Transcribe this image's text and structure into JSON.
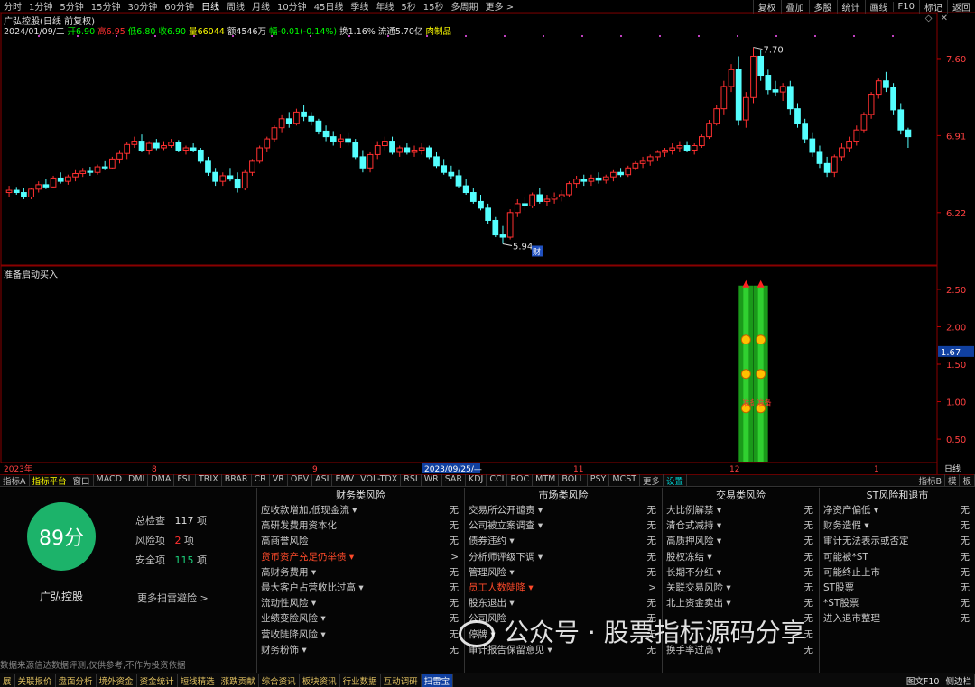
{
  "timeframes": [
    "分时",
    "1分钟",
    "5分钟",
    "15分钟",
    "30分钟",
    "60分钟",
    "日线",
    "周线",
    "月线",
    "10分钟",
    "45日线",
    "季线",
    "年线",
    "5秒",
    "15秒",
    "多周期",
    "更多 >"
  ],
  "active_timeframe_index": 6,
  "right_buttons": [
    "复权",
    "叠加",
    "多股",
    "统计",
    "画线",
    "F10",
    "标记",
    "返回"
  ],
  "chart_title": "广弘控股(日线 前复权)",
  "quote": [
    {
      "text": "2024/01/09/二",
      "color": "#e0e0e0"
    },
    {
      "text": "开6.90",
      "color": "#00ff00"
    },
    {
      "text": "高6.95",
      "color": "#ff3030"
    },
    {
      "text": "低6.80",
      "color": "#00ff00"
    },
    {
      "text": "收6.90",
      "color": "#00ff00"
    },
    {
      "text": "量66044",
      "color": "#ffff00"
    },
    {
      "text": "额4546万",
      "color": "#e0e0e0"
    },
    {
      "text": "幅-0.01(-0.14%)",
      "color": "#00ff00"
    },
    {
      "text": "换1.16%",
      "color": "#e0e0e0"
    },
    {
      "text": "流通5.70亿",
      "color": "#e0e0e0"
    },
    {
      "text": "肉制品",
      "color": "#ffff00"
    }
  ],
  "price_axis": [
    "7.60",
    "6.91",
    "6.22"
  ],
  "price_marks": {
    "high": "7.70",
    "low": "5.94",
    "fin": "财"
  },
  "indicator_title": "准备启动买入",
  "indicator_axis": [
    "2.50",
    "2.00",
    "1.50",
    "1.00",
    "0.50"
  ],
  "indicator_current": "1.67",
  "bar_label": "准备",
  "date_axis": [
    "2023年",
    "8",
    "9",
    "2023/09/25/—",
    "11",
    "12",
    "1"
  ],
  "period_label": "日线",
  "indicator_tabs": [
    "指标A",
    "指标平台",
    "窗口",
    "MACD",
    "DMI",
    "DMA",
    "FSL",
    "TRIX",
    "BRAR",
    "CR",
    "VR",
    "OBV",
    "ASI",
    "EMV",
    "VOL-TDX",
    "RSI",
    "WR",
    "SAR",
    "KDJ",
    "CCI",
    "ROC",
    "MTM",
    "BOLL",
    "PSY",
    "MCST",
    "更多",
    "设置"
  ],
  "indicator_tabs_right": [
    "指标B",
    "模",
    "板"
  ],
  "score": "89分",
  "stock_name": "广弘控股",
  "stats": {
    "total_label": "总检查",
    "total": "117",
    "unit": "项",
    "risk_label": "风险项",
    "risk": "2",
    "safe_label": "安全项",
    "safe": "115"
  },
  "more_link": "更多扫雷避险 >",
  "disclaimer": "数据来源信达数据评测,仅供参考,不作为投资依据",
  "risk_columns": [
    {
      "title": "财务类风险",
      "rows": [
        {
          "label": "应收款增加,低现金流 ▾",
          "value": "无",
          "warn": false
        },
        {
          "label": "高研发费用资本化",
          "value": "无",
          "warn": false
        },
        {
          "label": "高商誉风险",
          "value": "无",
          "warn": false
        },
        {
          "label": "货币资产充足仍举债 ▾",
          "value": ">",
          "warn": true
        },
        {
          "label": "高财务费用 ▾",
          "value": "无",
          "warn": false
        },
        {
          "label": "最大客户占营收比过高 ▾",
          "value": "无",
          "warn": false
        },
        {
          "label": "流动性风险 ▾",
          "value": "无",
          "warn": false
        },
        {
          "label": "业绩变脸风险 ▾",
          "value": "无",
          "warn": false
        },
        {
          "label": "营收陡降风险 ▾",
          "value": "无",
          "warn": false
        },
        {
          "label": "财务粉饰 ▾",
          "value": "无",
          "warn": false
        }
      ]
    },
    {
      "title": "市场类风险",
      "rows": [
        {
          "label": "交易所公开谴责 ▾",
          "value": "无",
          "warn": false
        },
        {
          "label": "公司被立案调查 ▾",
          "value": "无",
          "warn": false
        },
        {
          "label": "债券违约 ▾",
          "value": "无",
          "warn": false
        },
        {
          "label": "分析师评级下调 ▾",
          "value": "无",
          "warn": false
        },
        {
          "label": "管理风险 ▾",
          "value": "无",
          "warn": false
        },
        {
          "label": "员工人数陡降 ▾",
          "value": ">",
          "warn": true
        },
        {
          "label": "股东退出 ▾",
          "value": "无",
          "warn": false
        },
        {
          "label": "公司风险",
          "value": "无",
          "warn": false
        },
        {
          "label": "停牌 ▾",
          "value": "无",
          "warn": false
        },
        {
          "label": "审计报告保留意见 ▾",
          "value": "无",
          "warn": false
        }
      ]
    },
    {
      "title": "交易类风险",
      "rows": [
        {
          "label": "大比例解禁 ▾",
          "value": "无",
          "warn": false
        },
        {
          "label": "清仓式减持 ▾",
          "value": "无",
          "warn": false
        },
        {
          "label": "高质押风险 ▾",
          "value": "无",
          "warn": false
        },
        {
          "label": "股权冻结 ▾",
          "value": "无",
          "warn": false
        },
        {
          "label": "长期不分红 ▾",
          "value": "无",
          "warn": false
        },
        {
          "label": "关联交易风险 ▾",
          "value": "无",
          "warn": false
        },
        {
          "label": "北上资金卖出 ▾",
          "value": "无",
          "warn": false
        },
        {
          "label": "",
          "value": "无",
          "warn": false
        },
        {
          "label": "",
          "value": "无",
          "warn": false
        },
        {
          "label": "换手率过高 ▾",
          "value": "无",
          "warn": false
        }
      ]
    },
    {
      "title": "ST风险和退市",
      "rows": [
        {
          "label": "净资产偏低 ▾",
          "value": "无",
          "warn": false
        },
        {
          "label": "财务造假 ▾",
          "value": "无",
          "warn": false
        },
        {
          "label": "审计无法表示或否定",
          "value": "无",
          "warn": false
        },
        {
          "label": "可能被*ST",
          "value": "无",
          "warn": false
        },
        {
          "label": "可能终止上市",
          "value": "无",
          "warn": false
        },
        {
          "label": "ST股票",
          "value": "无",
          "warn": false
        },
        {
          "label": "*ST股票",
          "value": "无",
          "warn": false
        },
        {
          "label": "进入退市整理",
          "value": "无",
          "warn": false
        },
        {
          "label": "",
          "value": "",
          "warn": false
        },
        {
          "label": "",
          "value": "",
          "warn": false
        }
      ]
    }
  ],
  "status_items": [
    "展",
    "关联报价",
    "盘面分析",
    "境外资金",
    "资金统计",
    "短线精选",
    "涨跌贡献",
    "综合资讯",
    "板块资讯",
    "行业数据",
    "互动调研",
    "扫雷宝"
  ],
  "status_active_index": 11,
  "status_right": [
    "图文F10",
    "侧边栏"
  ],
  "watermark": "公众号 · 股票指标源码分享",
  "chart_data": {
    "type": "candlestick",
    "price_range": [
      5.75,
      7.85
    ],
    "ohlc": [
      [
        6.4,
        6.46,
        6.36,
        6.42
      ],
      [
        6.42,
        6.45,
        6.38,
        6.4
      ],
      [
        6.4,
        6.44,
        6.34,
        6.36
      ],
      [
        6.36,
        6.44,
        6.34,
        6.43
      ],
      [
        6.43,
        6.5,
        6.4,
        6.47
      ],
      [
        6.47,
        6.52,
        6.43,
        6.45
      ],
      [
        6.45,
        6.55,
        6.44,
        6.53
      ],
      [
        6.53,
        6.58,
        6.48,
        6.5
      ],
      [
        6.5,
        6.56,
        6.47,
        6.54
      ],
      [
        6.54,
        6.6,
        6.5,
        6.57
      ],
      [
        6.57,
        6.62,
        6.54,
        6.59
      ],
      [
        6.59,
        6.63,
        6.55,
        6.58
      ],
      [
        6.58,
        6.65,
        6.56,
        6.63
      ],
      [
        6.63,
        6.68,
        6.6,
        6.62
      ],
      [
        6.62,
        6.72,
        6.61,
        6.7
      ],
      [
        6.7,
        6.78,
        6.66,
        6.75
      ],
      [
        6.75,
        6.85,
        6.7,
        6.83
      ],
      [
        6.83,
        6.9,
        6.8,
        6.86
      ],
      [
        6.86,
        6.92,
        6.76,
        6.78
      ],
      [
        6.78,
        6.86,
        6.74,
        6.84
      ],
      [
        6.84,
        6.88,
        6.78,
        6.8
      ],
      [
        6.8,
        6.86,
        6.78,
        6.82
      ],
      [
        6.82,
        6.88,
        6.8,
        6.85
      ],
      [
        6.85,
        6.87,
        6.76,
        6.78
      ],
      [
        6.78,
        6.82,
        6.74,
        6.8
      ],
      [
        6.8,
        6.84,
        6.76,
        6.78
      ],
      [
        6.78,
        6.8,
        6.66,
        6.68
      ],
      [
        6.68,
        6.72,
        6.55,
        6.58
      ],
      [
        6.58,
        6.62,
        6.46,
        6.5
      ],
      [
        6.5,
        6.58,
        6.46,
        6.55
      ],
      [
        6.55,
        6.62,
        6.5,
        6.52
      ],
      [
        6.52,
        6.58,
        6.4,
        6.44
      ],
      [
        6.44,
        6.6,
        6.42,
        6.58
      ],
      [
        6.58,
        6.7,
        6.55,
        6.68
      ],
      [
        6.68,
        6.82,
        6.66,
        6.8
      ],
      [
        6.8,
        6.9,
        6.76,
        6.88
      ],
      [
        6.88,
        7.0,
        6.85,
        6.98
      ],
      [
        6.98,
        7.1,
        6.94,
        7.06
      ],
      [
        7.06,
        7.12,
        6.98,
        7.02
      ],
      [
        7.02,
        7.15,
        7.0,
        7.12
      ],
      [
        7.12,
        7.18,
        7.04,
        7.08
      ],
      [
        7.08,
        7.12,
        7.0,
        7.04
      ],
      [
        7.04,
        7.06,
        6.92,
        6.95
      ],
      [
        6.95,
        7.0,
        6.86,
        6.9
      ],
      [
        6.9,
        6.95,
        6.82,
        6.86
      ],
      [
        6.86,
        6.92,
        6.8,
        6.88
      ],
      [
        6.88,
        6.94,
        6.82,
        6.85
      ],
      [
        6.85,
        6.88,
        6.7,
        6.72
      ],
      [
        6.72,
        6.78,
        6.58,
        6.62
      ],
      [
        6.62,
        6.76,
        6.58,
        6.74
      ],
      [
        6.74,
        6.86,
        6.7,
        6.82
      ],
      [
        6.82,
        6.9,
        6.78,
        6.86
      ],
      [
        6.86,
        6.9,
        6.74,
        6.76
      ],
      [
        6.76,
        6.82,
        6.72,
        6.8
      ],
      [
        6.8,
        6.84,
        6.74,
        6.76
      ],
      [
        6.76,
        6.82,
        6.72,
        6.78
      ],
      [
        6.78,
        6.84,
        6.74,
        6.8
      ],
      [
        6.8,
        6.82,
        6.7,
        6.72
      ],
      [
        6.72,
        6.76,
        6.62,
        6.64
      ],
      [
        6.64,
        6.7,
        6.56,
        6.58
      ],
      [
        6.58,
        6.64,
        6.52,
        6.55
      ],
      [
        6.55,
        6.6,
        6.44,
        6.46
      ],
      [
        6.46,
        6.52,
        6.38,
        6.4
      ],
      [
        6.4,
        6.44,
        6.3,
        6.32
      ],
      [
        6.32,
        6.38,
        6.24,
        6.26
      ],
      [
        6.26,
        6.3,
        6.12,
        6.15
      ],
      [
        6.15,
        6.18,
        6.0,
        6.02
      ],
      [
        6.02,
        6.1,
        5.94,
        6.0
      ],
      [
        6.0,
        6.25,
        5.98,
        6.22
      ],
      [
        6.22,
        6.34,
        6.18,
        6.3
      ],
      [
        6.3,
        6.36,
        6.24,
        6.28
      ],
      [
        6.28,
        6.4,
        6.26,
        6.38
      ],
      [
        6.38,
        6.44,
        6.3,
        6.32
      ],
      [
        6.32,
        6.38,
        6.28,
        6.34
      ],
      [
        6.34,
        6.4,
        6.3,
        6.36
      ],
      [
        6.36,
        6.42,
        6.32,
        6.38
      ],
      [
        6.38,
        6.5,
        6.36,
        6.48
      ],
      [
        6.48,
        6.55,
        6.44,
        6.52
      ],
      [
        6.52,
        6.56,
        6.46,
        6.5
      ],
      [
        6.5,
        6.56,
        6.46,
        6.53
      ],
      [
        6.53,
        6.58,
        6.48,
        6.51
      ],
      [
        6.51,
        6.56,
        6.48,
        6.54
      ],
      [
        6.54,
        6.6,
        6.5,
        6.58
      ],
      [
        6.58,
        6.62,
        6.54,
        6.56
      ],
      [
        6.56,
        6.64,
        6.54,
        6.62
      ],
      [
        6.62,
        6.68,
        6.6,
        6.66
      ],
      [
        6.66,
        6.72,
        6.62,
        6.68
      ],
      [
        6.68,
        6.74,
        6.64,
        6.72
      ],
      [
        6.72,
        6.78,
        6.68,
        6.76
      ],
      [
        6.76,
        6.8,
        6.72,
        6.78
      ],
      [
        6.78,
        6.84,
        6.74,
        6.8
      ],
      [
        6.8,
        6.86,
        6.76,
        6.82
      ],
      [
        6.82,
        6.86,
        6.76,
        6.78
      ],
      [
        6.78,
        6.84,
        6.74,
        6.82
      ],
      [
        6.82,
        6.92,
        6.8,
        6.9
      ],
      [
        6.9,
        7.05,
        6.88,
        7.02
      ],
      [
        7.02,
        7.18,
        7.0,
        7.15
      ],
      [
        7.15,
        7.4,
        7.1,
        7.35
      ],
      [
        7.35,
        7.55,
        7.3,
        7.5
      ],
      [
        7.5,
        7.62,
        7.0,
        7.05
      ],
      [
        7.05,
        7.3,
        6.98,
        7.25
      ],
      [
        7.25,
        7.7,
        7.2,
        7.62
      ],
      [
        7.62,
        7.68,
        7.4,
        7.45
      ],
      [
        7.45,
        7.5,
        7.28,
        7.32
      ],
      [
        7.32,
        7.4,
        7.26,
        7.3
      ],
      [
        7.3,
        7.38,
        7.22,
        7.35
      ],
      [
        7.35,
        7.4,
        7.1,
        7.15
      ],
      [
        7.15,
        7.2,
        6.98,
        7.02
      ],
      [
        7.02,
        7.06,
        6.84,
        6.88
      ],
      [
        6.88,
        6.94,
        6.72,
        6.76
      ],
      [
        6.76,
        6.82,
        6.62,
        6.66
      ],
      [
        6.66,
        6.72,
        6.54,
        6.58
      ],
      [
        6.58,
        6.74,
        6.54,
        6.72
      ],
      [
        6.72,
        6.84,
        6.68,
        6.8
      ],
      [
        6.8,
        6.9,
        6.76,
        6.86
      ],
      [
        6.86,
        7.0,
        6.82,
        6.96
      ],
      [
        6.96,
        7.12,
        6.94,
        7.1
      ],
      [
        7.1,
        7.3,
        7.06,
        7.28
      ],
      [
        7.28,
        7.42,
        7.24,
        7.4
      ],
      [
        7.4,
        7.48,
        7.3,
        7.34
      ],
      [
        7.34,
        7.38,
        7.1,
        7.14
      ],
      [
        7.14,
        7.2,
        6.92,
        6.96
      ],
      [
        6.96,
        6.98,
        6.8,
        6.9
      ]
    ],
    "signals": [
      {
        "candle_index": 100,
        "value": 2.55,
        "markers": 3
      },
      {
        "candle_index": 102,
        "value": 2.55,
        "markers": 3
      }
    ],
    "indicator_range": [
      0.2,
      2.8
    ]
  }
}
